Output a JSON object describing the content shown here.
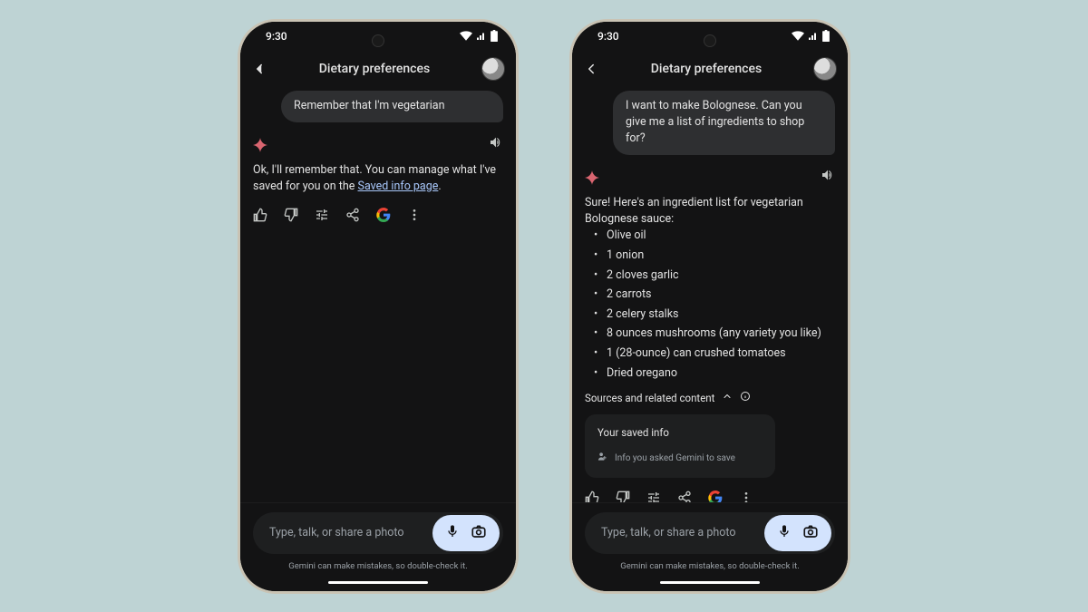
{
  "status": {
    "time": "9:30"
  },
  "header": {
    "title": "Dietary preferences"
  },
  "phone1": {
    "user_msg": "Remember that I'm vegetarian",
    "assistant_pre": "Ok, I'll remember that. You can manage what I've saved for you on the ",
    "assistant_link": "Saved info page",
    "assistant_post": "."
  },
  "phone2": {
    "user_msg": "I want to make Bolognese. Can you give me a list of ingredients to shop for?",
    "assistant_intro": "Sure! Here's an ingredient list for vegetarian Bolognese sauce:",
    "ingredients": [
      "Olive oil",
      "1 onion",
      "2 cloves garlic",
      "2 carrots",
      "2 celery stalks",
      "8 ounces mushrooms (any variety you like)",
      "1 (28-ounce) can crushed tomatoes",
      "Dried oregano"
    ],
    "sources_label": "Sources and related content",
    "saved_card": {
      "title": "Your saved info",
      "subtitle": "Info you asked Gemini to save"
    }
  },
  "input": {
    "placeholder": "Type, talk, or share a photo"
  },
  "disclaimer": "Gemini can make mistakes, so double-check it."
}
